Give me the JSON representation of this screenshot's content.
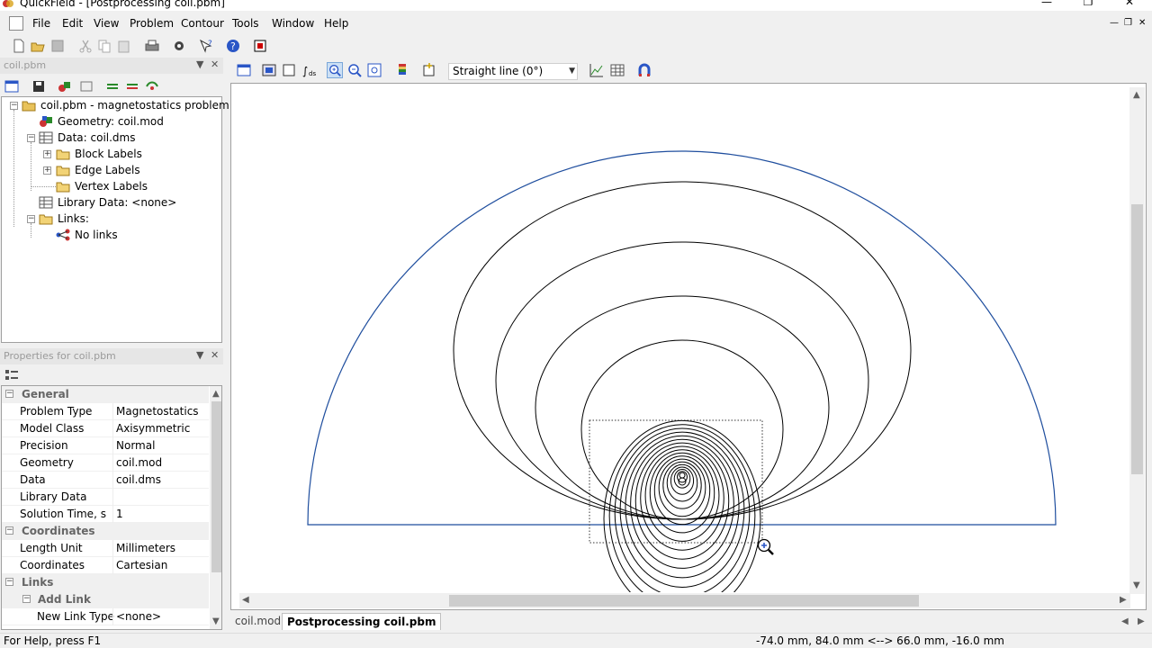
{
  "window": {
    "title": "QuickField - [Postprocessing coil.pbm]"
  },
  "menu": {
    "items": [
      "File",
      "Edit",
      "View",
      "Problem",
      "Contour",
      "Tools",
      "Window",
      "Help"
    ]
  },
  "tree_panel": {
    "title": "coil.pbm",
    "items": [
      {
        "label": "coil.pbm - magnetostatics problem",
        "icon": "folder-open-icon"
      },
      {
        "label": "Geometry: coil.mod",
        "icon": "geometry-icon"
      },
      {
        "label": "Data: coil.dms",
        "icon": "table-icon"
      },
      {
        "label": "Block Labels",
        "icon": "folder-icon"
      },
      {
        "label": "Edge Labels",
        "icon": "folder-icon"
      },
      {
        "label": "Vertex Labels",
        "icon": "folder-icon"
      },
      {
        "label": "Library Data: <none>",
        "icon": "table-icon"
      },
      {
        "label": "Links:",
        "icon": "folder-open-icon"
      },
      {
        "label": "No links",
        "icon": "link-icon"
      }
    ]
  },
  "properties_panel": {
    "title": "Properties for coil.pbm",
    "categories": [
      {
        "name": "General",
        "rows": [
          {
            "key": "Problem Type",
            "value": "Magnetostatics"
          },
          {
            "key": "Model Class",
            "value": "Axisymmetric"
          },
          {
            "key": "Precision",
            "value": "Normal"
          },
          {
            "key": "Geometry",
            "value": "coil.mod"
          },
          {
            "key": "Data",
            "value": "coil.dms"
          },
          {
            "key": "Library Data",
            "value": ""
          },
          {
            "key": "Solution Time, s",
            "value": "1"
          }
        ]
      },
      {
        "name": "Coordinates",
        "rows": [
          {
            "key": "Length Unit",
            "value": "Millimeters"
          },
          {
            "key": "Coordinates",
            "value": "Cartesian"
          }
        ]
      },
      {
        "name": "Links",
        "rows": []
      },
      {
        "name": "Add Link",
        "rows": [
          {
            "key": "New Link Type",
            "value": "<none>"
          }
        ]
      }
    ]
  },
  "view_toolbar": {
    "contour_mode": "Straight line (0°)"
  },
  "doc_tabs": [
    "coil.mod",
    "Postprocessing coil.pbm"
  ],
  "status": {
    "help": "For Help, press F1",
    "coords": "-74.0 mm, 84.0 mm <--> 66.0 mm, -16.0 mm"
  },
  "colors": {
    "boundary": "#1f4e9e",
    "field_lines": "#000000",
    "zoom_icon": "#2a56c6"
  }
}
